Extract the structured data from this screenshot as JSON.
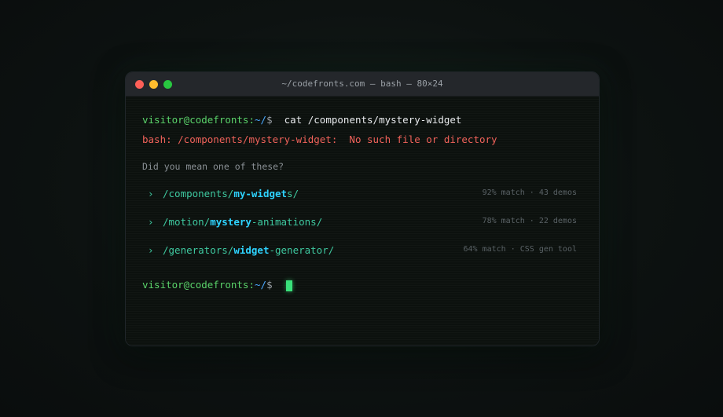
{
  "window": {
    "title": "~/codefronts.com — bash — 80×24"
  },
  "terminal": {
    "prompt_user": "visitor@codefronts:",
    "prompt_path": "~/",
    "prompt_symbol": "$",
    "command": "cat /components/mystery-widget",
    "error_prefix": "bash: /components/mystery-widget:",
    "error_message": "No such file or directory",
    "hint": "Did you mean one of these?",
    "suggestions": [
      {
        "chevron": "›",
        "pre": "/components/",
        "highlight": "my-widget",
        "post": "s/",
        "meta": "92% match · 43 demos"
      },
      {
        "chevron": "›",
        "pre": "/motion/",
        "highlight": "mystery",
        "post": "-animations/",
        "meta": "78% match · 22 demos"
      },
      {
        "chevron": "›",
        "pre": "/generators/",
        "highlight": "widget",
        "post": "-generator/",
        "meta": "64% match · CSS gen tool"
      }
    ]
  },
  "colors": {
    "prompt": "#5ad36a",
    "path": "#4aa8ff",
    "error": "#f0625a",
    "suggestion": "#3ec9a0",
    "highlight": "#2ed3ff",
    "cursor": "#39e07a"
  }
}
